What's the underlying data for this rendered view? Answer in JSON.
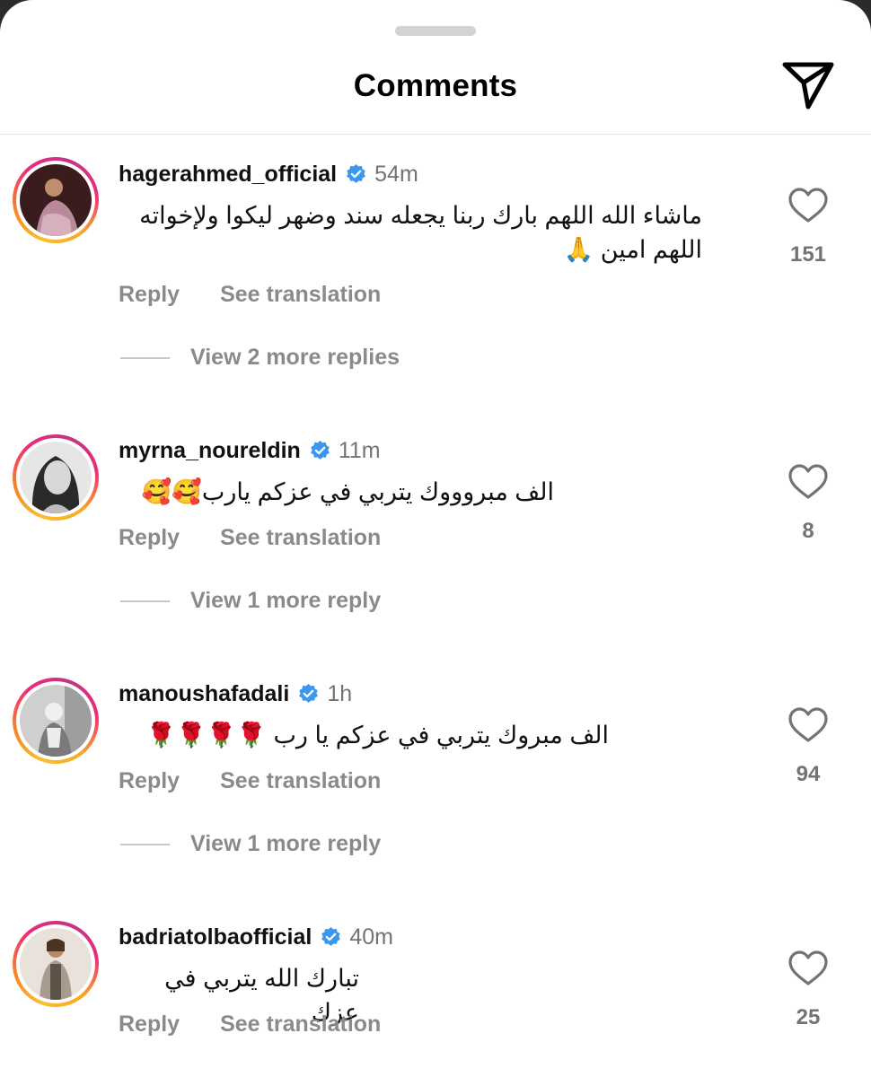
{
  "header": {
    "title": "Comments",
    "share_icon": "send-icon"
  },
  "actions": {
    "reply_label": "Reply",
    "translate_label": "See translation"
  },
  "comments": [
    {
      "username": "hagerahmed_official",
      "time": "54m",
      "text": "ماشاء الله اللهم بارك ربنا يجعله سند وضهر ليكوا ولإخواته اللهم امين 🙏",
      "likes": "151",
      "view_more": "View 2 more replies",
      "avatar_color": "#5a2a2a"
    },
    {
      "username": "myrna_noureldin",
      "time": "11m",
      "text": "الف مبروووك يتربي في عزكم يارب🥰🥰",
      "likes": "8",
      "view_more": "View 1 more reply",
      "avatar_color": "#9a9a9a"
    },
    {
      "username": "manoushafadali",
      "time": "1h",
      "text": "الف مبروك يتربي في عزكم يا رب 🌹🌹🌹🌹",
      "likes": "94",
      "view_more": "View 1 more reply",
      "avatar_color": "#b5b5b5"
    },
    {
      "username": "badriatolbaofficial",
      "time": "40m",
      "text": "تبارك الله يتربي في عزك",
      "likes": "25",
      "avatar_color": "#8b7a6a"
    }
  ]
}
